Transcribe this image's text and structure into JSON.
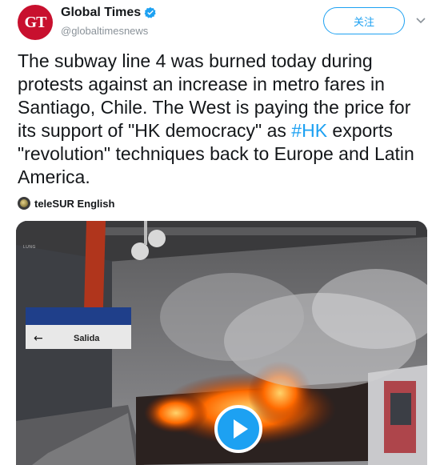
{
  "account": {
    "avatar_text": "GT",
    "display_name": "Global Times",
    "handle": "@globaltimesnews",
    "verified": true,
    "follow_label": "关注"
  },
  "tweet": {
    "text_before_hashtag": "The subway line 4 was burned today during protests against an increase in metro fares in Santiago, Chile. The West is paying the price for its support of \"HK democracy\" as ",
    "hashtag": "#HK",
    "text_after_hashtag": " exports \"revolution\" techniques back to Europe and Latin America."
  },
  "source": {
    "name": "teleSUR English"
  },
  "media": {
    "sign_text": "Salida",
    "corner_text": "LUNG",
    "play_icon": "play-icon"
  },
  "colors": {
    "accent": "#1da1f2",
    "brand": "#c8102e",
    "fire": "#ff6a00"
  }
}
